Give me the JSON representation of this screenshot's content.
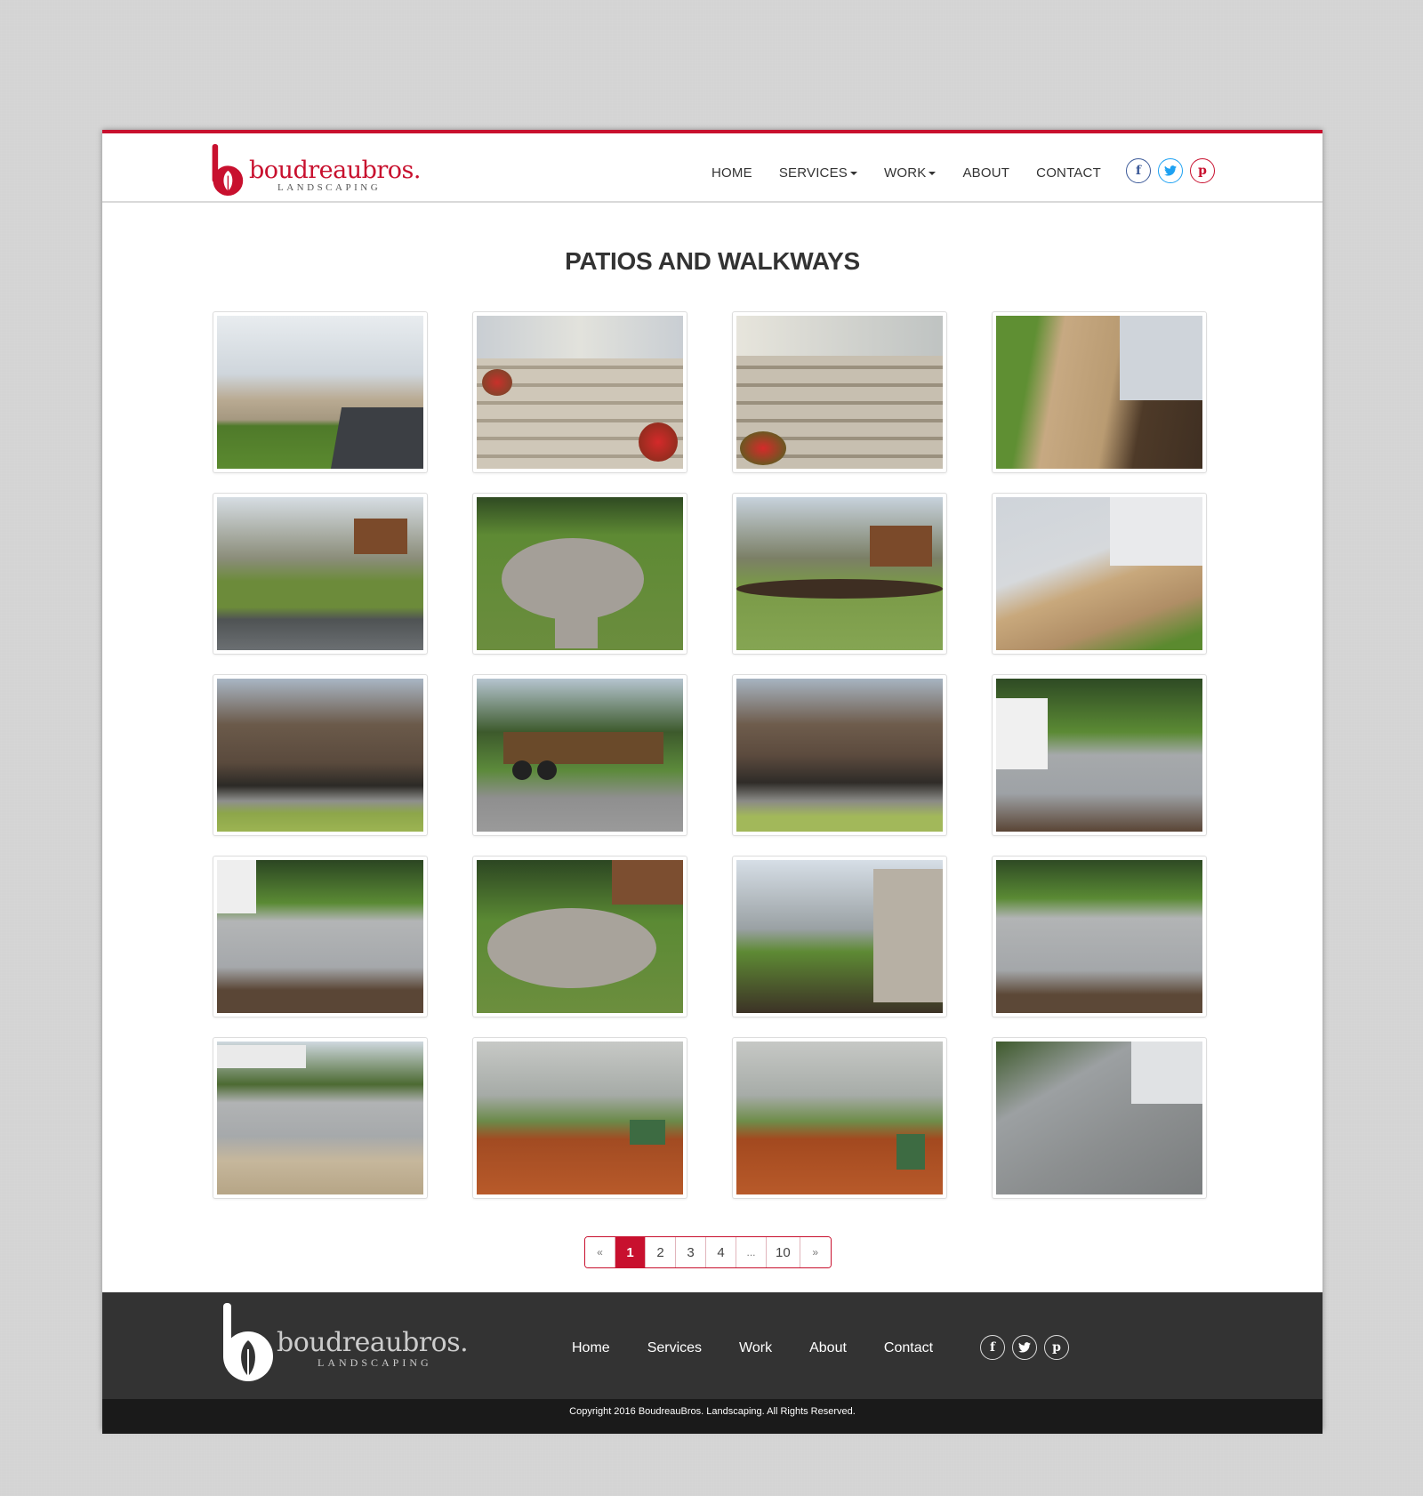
{
  "brand": {
    "name_part1": "boudreau",
    "name_part2": "bros.",
    "subtitle": "LANDSCAPING",
    "accent_color": "#c8102e"
  },
  "nav": {
    "items": [
      {
        "label": "HOME",
        "dropdown": false
      },
      {
        "label": "SERVICES",
        "dropdown": true
      },
      {
        "label": "WORK",
        "dropdown": true
      },
      {
        "label": "ABOUT",
        "dropdown": false
      },
      {
        "label": "CONTACT",
        "dropdown": false
      }
    ],
    "social": [
      {
        "icon": "facebook-icon",
        "glyph": "f"
      },
      {
        "icon": "twitter-icon",
        "glyph": "t"
      },
      {
        "icon": "pinterest-icon",
        "glyph": "p"
      }
    ]
  },
  "page": {
    "title": "PATIOS AND WALKWAYS"
  },
  "gallery": {
    "photos": [
      {
        "subject": "front-steps-and-curved-walkway"
      },
      {
        "subject": "paver-front-steps-with-flowers"
      },
      {
        "subject": "paver-front-steps-closeup"
      },
      {
        "subject": "curved-paver-walkway-to-steps"
      },
      {
        "subject": "retaining-wall-and-pergola"
      },
      {
        "subject": "round-paver-patio-on-lawn"
      },
      {
        "subject": "lawn-tree-and-pergola"
      },
      {
        "subject": "steps-and-walkway-by-garage"
      },
      {
        "subject": "boulder-garden-in-woods"
      },
      {
        "subject": "sod-delivery-on-trailer"
      },
      {
        "subject": "boulder-landscaping-in-woods"
      },
      {
        "subject": "paver-patio-with-fire-pit-and-deck"
      },
      {
        "subject": "paver-patio-fire-pit-wide"
      },
      {
        "subject": "circular-patio-by-deck"
      },
      {
        "subject": "crew-working-by-stone-house"
      },
      {
        "subject": "patio-fire-pit-with-plantings"
      },
      {
        "subject": "fire-pit-patio-with-new-plants"
      },
      {
        "subject": "crew-spreading-mulch"
      },
      {
        "subject": "crew-mulching-near-road"
      },
      {
        "subject": "walkway-base-preparation"
      }
    ]
  },
  "pagination": {
    "prev": "«",
    "pages": [
      "1",
      "2",
      "3",
      "4",
      "...",
      "10"
    ],
    "next": "»",
    "current": "1"
  },
  "footer": {
    "nav": [
      "Home",
      "Services",
      "Work",
      "About",
      "Contact"
    ],
    "copyright": "Copyright 2016 BoudreauBros. Landscaping. All Rights Reserved."
  }
}
